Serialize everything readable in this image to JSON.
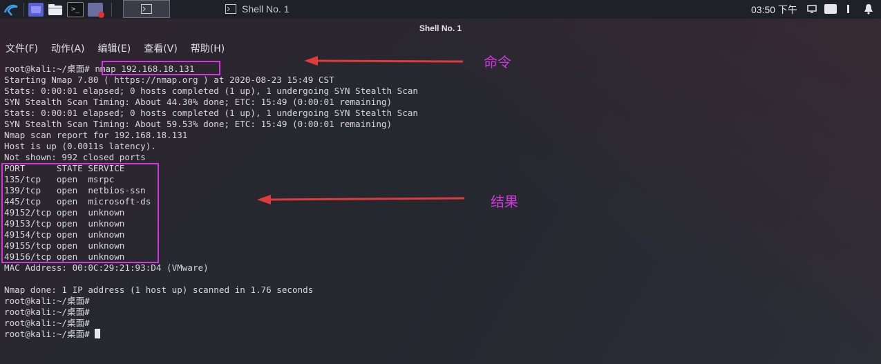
{
  "panel": {
    "window_title": "Shell No. 1",
    "clock": "03:50 下午"
  },
  "window": {
    "title": "Shell No. 1"
  },
  "menu": [
    "文件(F)",
    "动作(A)",
    "编辑(E)",
    "查看(V)",
    "帮助(H)"
  ],
  "terminal": {
    "prompt": "root@kali:~/桌面# ",
    "command": "nmap 192.168.18.131",
    "output_lines": [
      "Starting Nmap 7.80 ( https://nmap.org ) at 2020-08-23 15:49 CST",
      "Stats: 0:00:01 elapsed; 0 hosts completed (1 up), 1 undergoing SYN Stealth Scan",
      "SYN Stealth Scan Timing: About 44.30% done; ETC: 15:49 (0:00:01 remaining)",
      "Stats: 0:00:01 elapsed; 0 hosts completed (1 up), 1 undergoing SYN Stealth Scan",
      "SYN Stealth Scan Timing: About 59.53% done; ETC: 15:49 (0:00:01 remaining)",
      "Nmap scan report for 192.168.18.131",
      "Host is up (0.0011s latency).",
      "Not shown: 992 closed ports"
    ],
    "port_table": {
      "header": "PORT      STATE SERVICE",
      "rows": [
        "135/tcp   open  msrpc",
        "139/tcp   open  netbios-ssn",
        "445/tcp   open  microsoft-ds",
        "49152/tcp open  unknown",
        "49153/tcp open  unknown",
        "49154/tcp open  unknown",
        "49155/tcp open  unknown",
        "49156/tcp open  unknown"
      ]
    },
    "mac_line": "MAC Address: 00:0C:29:21:93:D4 (VMware)",
    "done_line": "Nmap done: 1 IP address (1 host up) scanned in 1.76 seconds",
    "empty_prompts": 3
  },
  "annotations": {
    "command_label": "命令",
    "result_label": "结果",
    "color": "#d437e0"
  },
  "icons": [
    "kali-menu-icon",
    "workspace-icon",
    "file-manager-icon",
    "terminal-icon",
    "screen-recorder-icon",
    "display-icon",
    "keyboard-layout-icon",
    "bell-icon"
  ]
}
